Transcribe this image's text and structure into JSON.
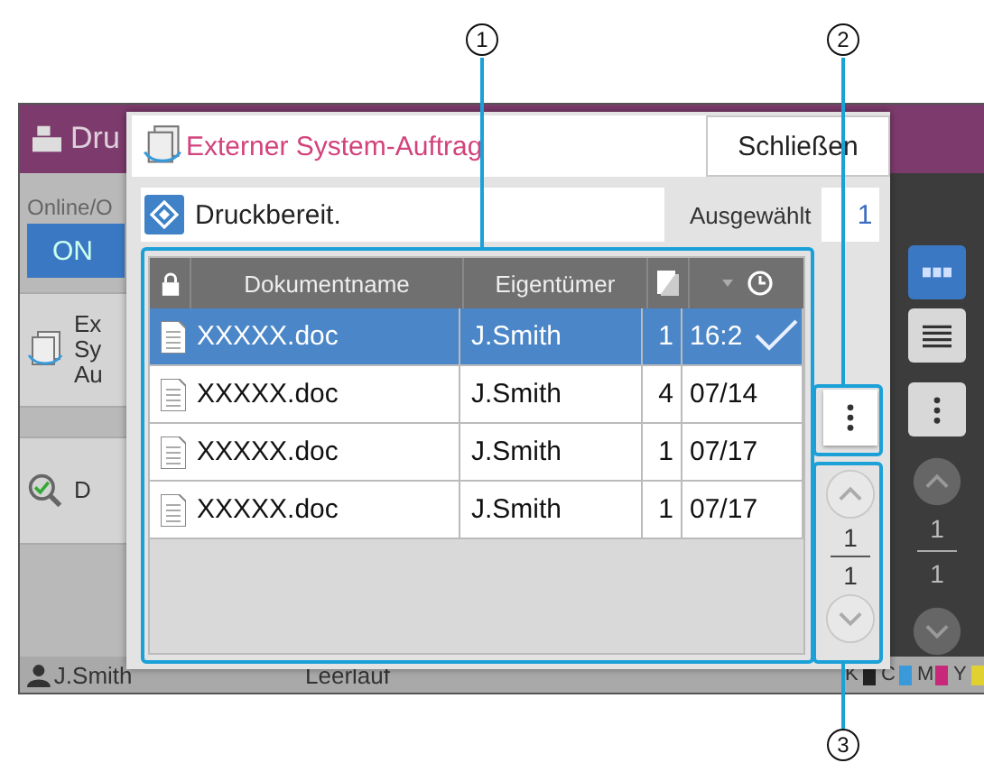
{
  "background_screen": {
    "title": "Dru",
    "online_label": "Online/O",
    "online_button": "ON",
    "menu_items": [
      {
        "kind": "job",
        "lines": [
          "Ex",
          "Sy",
          "Au"
        ]
      },
      {
        "kind": "search",
        "lines": [
          "D"
        ]
      }
    ],
    "side_buttons": [
      {
        "kind": "grid",
        "selected": true
      },
      {
        "kind": "list",
        "selected": false
      },
      {
        "kind": "more",
        "selected": false
      }
    ],
    "pager": {
      "current": "1",
      "total": "1"
    },
    "user": "J.Smith",
    "status": "Leerlauf",
    "toner": [
      {
        "label": "K",
        "color": "#222222"
      },
      {
        "label": "C",
        "color": "#3a9ad9"
      },
      {
        "label": "M",
        "color": "#c8287a"
      },
      {
        "label": "Y",
        "color": "#e0d030"
      }
    ]
  },
  "dialog": {
    "title": "Externer System-Auftrag",
    "close_button": "Schließen",
    "status": "Druckbereit.",
    "selected_label": "Ausgewählt",
    "selected_count": "1",
    "table": {
      "columns": [
        "Dokumentname",
        "Eigentümer"
      ],
      "rows": [
        {
          "name": "XXXXX.doc",
          "owner": "J.Smith",
          "copies": "1",
          "date": "16:2",
          "selected": true
        },
        {
          "name": "XXXXX.doc",
          "owner": "J.Smith",
          "copies": "4",
          "date": "07/14",
          "selected": false
        },
        {
          "name": "XXXXX.doc",
          "owner": "J.Smith",
          "copies": "1",
          "date": "07/17",
          "selected": false
        },
        {
          "name": "XXXXX.doc",
          "owner": "J.Smith",
          "copies": "1",
          "date": "07/17",
          "selected": false
        }
      ]
    },
    "pager": {
      "current": "1",
      "total": "1"
    }
  },
  "callouts": [
    {
      "number": "1"
    },
    {
      "number": "2"
    },
    {
      "number": "3"
    }
  ]
}
